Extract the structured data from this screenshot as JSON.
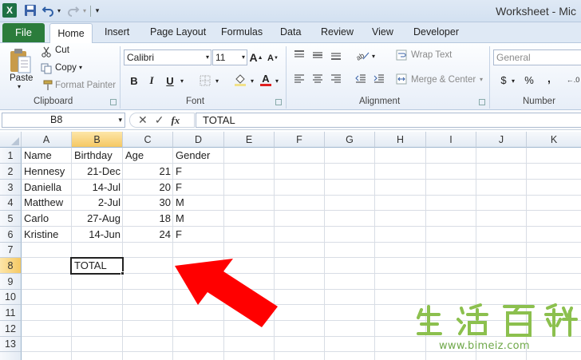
{
  "window": {
    "title": "Worksheet - Mic"
  },
  "qat": {
    "logo": "X",
    "save_icon": "save-icon",
    "undo_icon": "undo-icon",
    "redo_icon": "redo-icon"
  },
  "tabs": {
    "file": "File",
    "items": [
      "Home",
      "Insert",
      "Page Layout",
      "Formulas",
      "Data",
      "Review",
      "View",
      "Developer"
    ]
  },
  "ribbon": {
    "clipboard": {
      "label": "Clipboard",
      "paste": "Paste",
      "cut": "Cut",
      "copy": "Copy",
      "format_painter": "Format Painter"
    },
    "font": {
      "label": "Font",
      "name": "Calibri",
      "size": "11",
      "bold": "B",
      "italic": "I",
      "underline": "U",
      "font_color": "#e02020"
    },
    "alignment": {
      "label": "Alignment",
      "wrap_text": "Wrap Text",
      "merge_center": "Merge & Center"
    },
    "number": {
      "label": "Number",
      "format": "General",
      "currency": "$",
      "percent": "%",
      "comma": ","
    }
  },
  "formula_bar": {
    "name_box": "B8",
    "fx": "fx",
    "content": "TOTAL"
  },
  "grid": {
    "columns": [
      "A",
      "B",
      "C",
      "D",
      "E",
      "F",
      "G",
      "H",
      "I",
      "J",
      "K"
    ],
    "rows": [
      "1",
      "2",
      "3",
      "4",
      "5",
      "6",
      "7",
      "8",
      "9",
      "10",
      "11",
      "12",
      "13"
    ],
    "headers": {
      "name": "Name",
      "birthday": "Birthday",
      "age": "Age",
      "gender": "Gender"
    },
    "records": [
      {
        "name": "Hennesy",
        "birthday": "21-Dec",
        "age": "21",
        "gender": "F"
      },
      {
        "name": "Daniella",
        "birthday": "14-Jul",
        "age": "20",
        "gender": "F"
      },
      {
        "name": "Matthew",
        "birthday": "2-Jul",
        "age": "30",
        "gender": "M"
      },
      {
        "name": "Carlo",
        "birthday": "27-Aug",
        "age": "18",
        "gender": "M"
      },
      {
        "name": "Kristine",
        "birthday": "14-Jun",
        "age": "24",
        "gender": "F"
      }
    ],
    "total_label": "TOTAL",
    "selected_cell": "B8"
  },
  "colors": {
    "file_tab": "#2b7c3b",
    "arrow": "#ff0000",
    "selection_header": "#f5c863"
  },
  "watermark": {
    "glyphs": "生活百科",
    "url": "www.bimeiz.com"
  }
}
